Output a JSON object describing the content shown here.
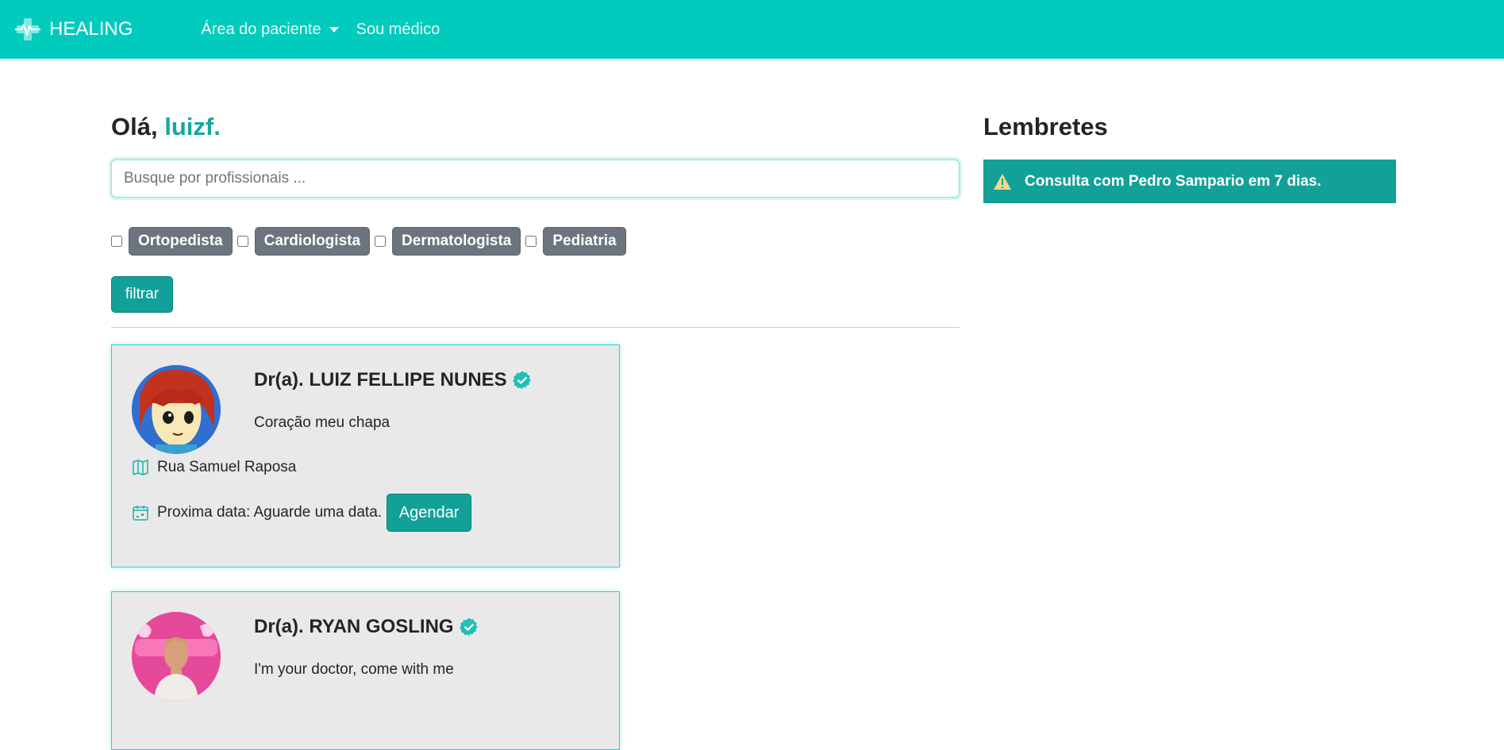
{
  "navbar": {
    "brand": "HEALING",
    "links": [
      {
        "label": "Área do paciente",
        "dropdown": true
      },
      {
        "label": "Sou médico",
        "dropdown": false
      }
    ]
  },
  "main": {
    "greeting_prefix": "Olá, ",
    "username": "luizf.",
    "search_placeholder": "Busque por profissionais ...",
    "filters": [
      "Ortopedista",
      "Cardiologista",
      "Dermatologista",
      "Pediatria"
    ],
    "filter_button": "filtrar",
    "doctors": [
      {
        "name": "Dr(a). LUIZ FELLIPE NUNES",
        "specialty": "Coração meu chapa",
        "address": "Rua Samuel Raposa",
        "next_date": "Proxima data: Aguarde uma data.",
        "schedule_button": "Agendar"
      },
      {
        "name": "Dr(a). RYAN GOSLING",
        "specialty": "I'm your doctor, come with me"
      }
    ]
  },
  "sidebar": {
    "title": "Lembretes",
    "reminders": [
      "Consulta com Pedro Sampario em 7 dias."
    ]
  },
  "colors": {
    "navbar": "#00cbbd",
    "accent": "#12a198",
    "badge": "#6c757d"
  }
}
